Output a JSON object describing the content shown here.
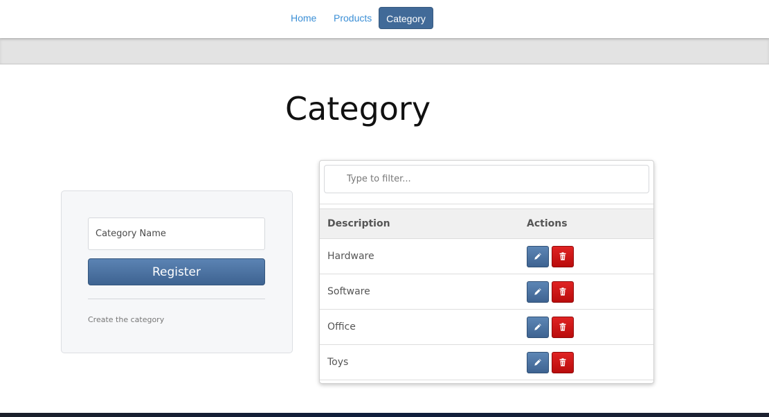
{
  "nav": {
    "home_label": "Home",
    "products_label": "Products",
    "category_label": "Category"
  },
  "page": {
    "title": "Category"
  },
  "form": {
    "category_name_placeholder": "Category Name",
    "category_name_value": "",
    "register_label": "Register",
    "help_text": "Create the category"
  },
  "table": {
    "filter_placeholder": "Type to filter...",
    "headers": {
      "description": "Description",
      "actions": "Actions"
    },
    "rows": [
      {
        "description": "Hardware"
      },
      {
        "description": "Software"
      },
      {
        "description": "Office"
      },
      {
        "description": "Toys"
      }
    ],
    "action_icons": [
      "pencil-icon",
      "trash-icon"
    ]
  },
  "colors": {
    "primary": "#416a98",
    "danger": "#c81414",
    "link": "#3b8fd6"
  }
}
